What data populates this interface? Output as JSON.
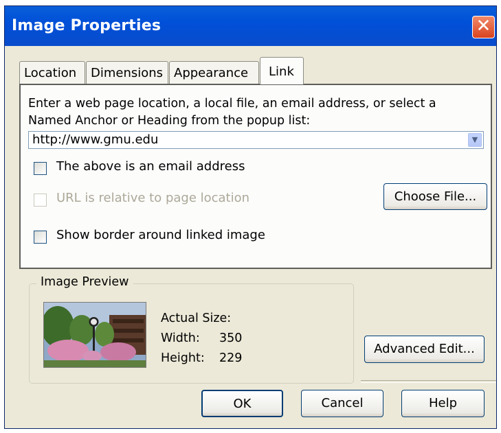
{
  "window": {
    "title": "Image Properties",
    "close_glyph": "✕"
  },
  "tabs": [
    {
      "label": "Location",
      "active": false
    },
    {
      "label": "Dimensions",
      "active": false
    },
    {
      "label": "Appearance",
      "active": false
    },
    {
      "label": "Link",
      "active": true
    }
  ],
  "link_panel": {
    "instructions": "Enter a web page location, a local file, an email address, or select a Named Anchor or Heading from the popup list:",
    "url_value": "http://www.gmu.edu",
    "dropdown_icon": "chevron-down-icon",
    "email_checkbox": {
      "label": "The above is an email address",
      "checked": false,
      "enabled": true
    },
    "relative_checkbox": {
      "label": "URL is relative to page location",
      "checked": false,
      "enabled": false
    },
    "border_checkbox": {
      "label": "Show border around linked image",
      "checked": false,
      "enabled": true
    },
    "choose_file_label": "Choose File..."
  },
  "preview": {
    "group_label": "Image Preview",
    "actual_size_label": "Actual Size:",
    "width_label": "Width:",
    "width_value": "350",
    "height_label": "Height:",
    "height_value": "229"
  },
  "buttons": {
    "advanced_edit": "Advanced Edit...",
    "ok": "OK",
    "cancel": "Cancel",
    "help": "Help"
  },
  "colors": {
    "titlebar": "#0054e3",
    "dialog_bg": "#ece9d8",
    "close_button": "#e0532f",
    "disabled_text": "#aca899"
  }
}
